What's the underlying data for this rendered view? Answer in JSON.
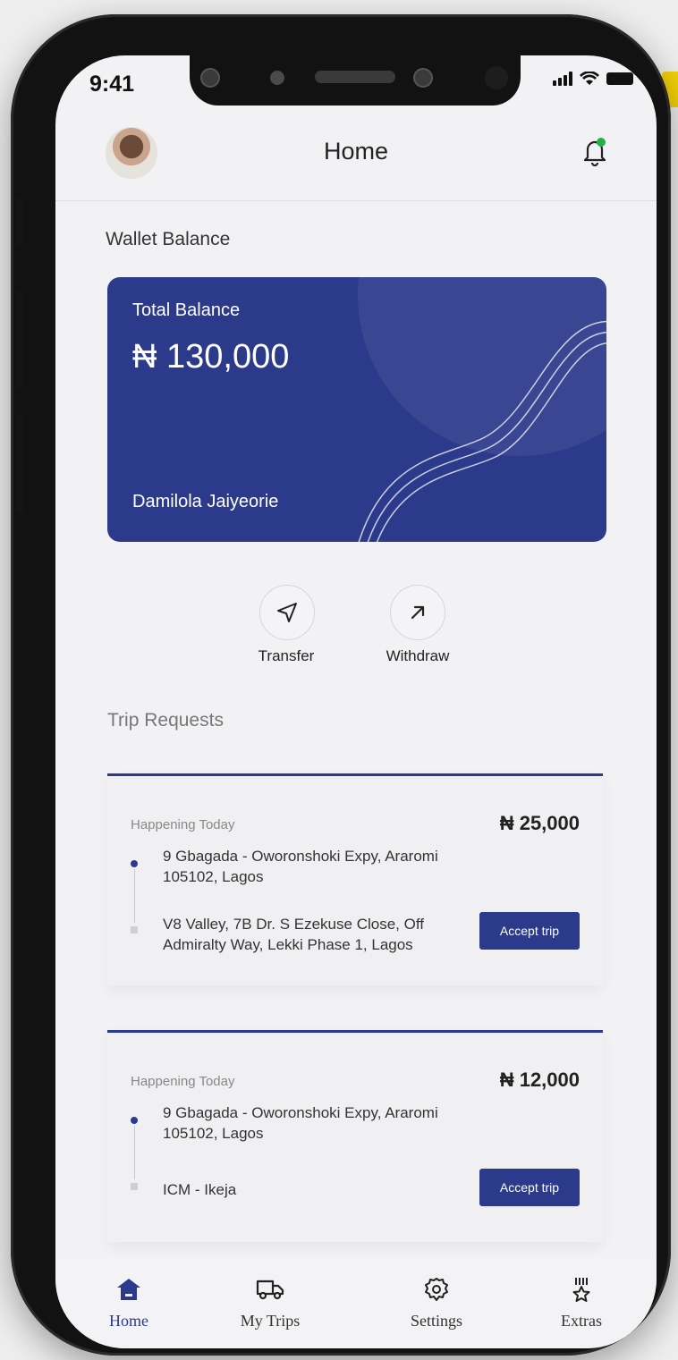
{
  "status_bar": {
    "time": "9:41"
  },
  "header": {
    "title": "Home"
  },
  "wallet": {
    "section_label": "Wallet Balance",
    "card_label": "Total Balance",
    "amount": "₦ 130,000",
    "holder": "Damilola Jaiyeorie"
  },
  "actions": [
    {
      "label": "Transfer",
      "icon": "send-icon"
    },
    {
      "label": "Withdraw",
      "icon": "arrow-up-right-icon"
    }
  ],
  "trips": {
    "section_label": "Trip Requests",
    "items": [
      {
        "when": "Happening Today",
        "price": "₦ 25,000",
        "from": "9 Gbagada - Oworonshoki Expy, Araromi 105102, Lagos",
        "to": "V8 Valley, 7B Dr. S Ezekuse Close, Off Admiralty Way, Lekki Phase 1, Lagos",
        "button": "Accept trip"
      },
      {
        "when": "Happening Today",
        "price": "₦ 12,000",
        "from": "9 Gbagada - Oworonshoki Expy, Araromi 105102, Lagos",
        "to": "ICM - Ikeja",
        "button": "Accept trip"
      }
    ]
  },
  "bottom_nav": [
    {
      "label": "Home",
      "icon": "home-icon",
      "active": true
    },
    {
      "label": "My Trips",
      "icon": "truck-icon",
      "active": false
    },
    {
      "label": "Settings",
      "icon": "gear-icon",
      "active": false
    },
    {
      "label": "Extras",
      "icon": "medal-icon",
      "active": false
    }
  ],
  "colors": {
    "primary": "#2b3a8a",
    "notification_dot": "#22b14c",
    "background": "#f2f2f4"
  }
}
